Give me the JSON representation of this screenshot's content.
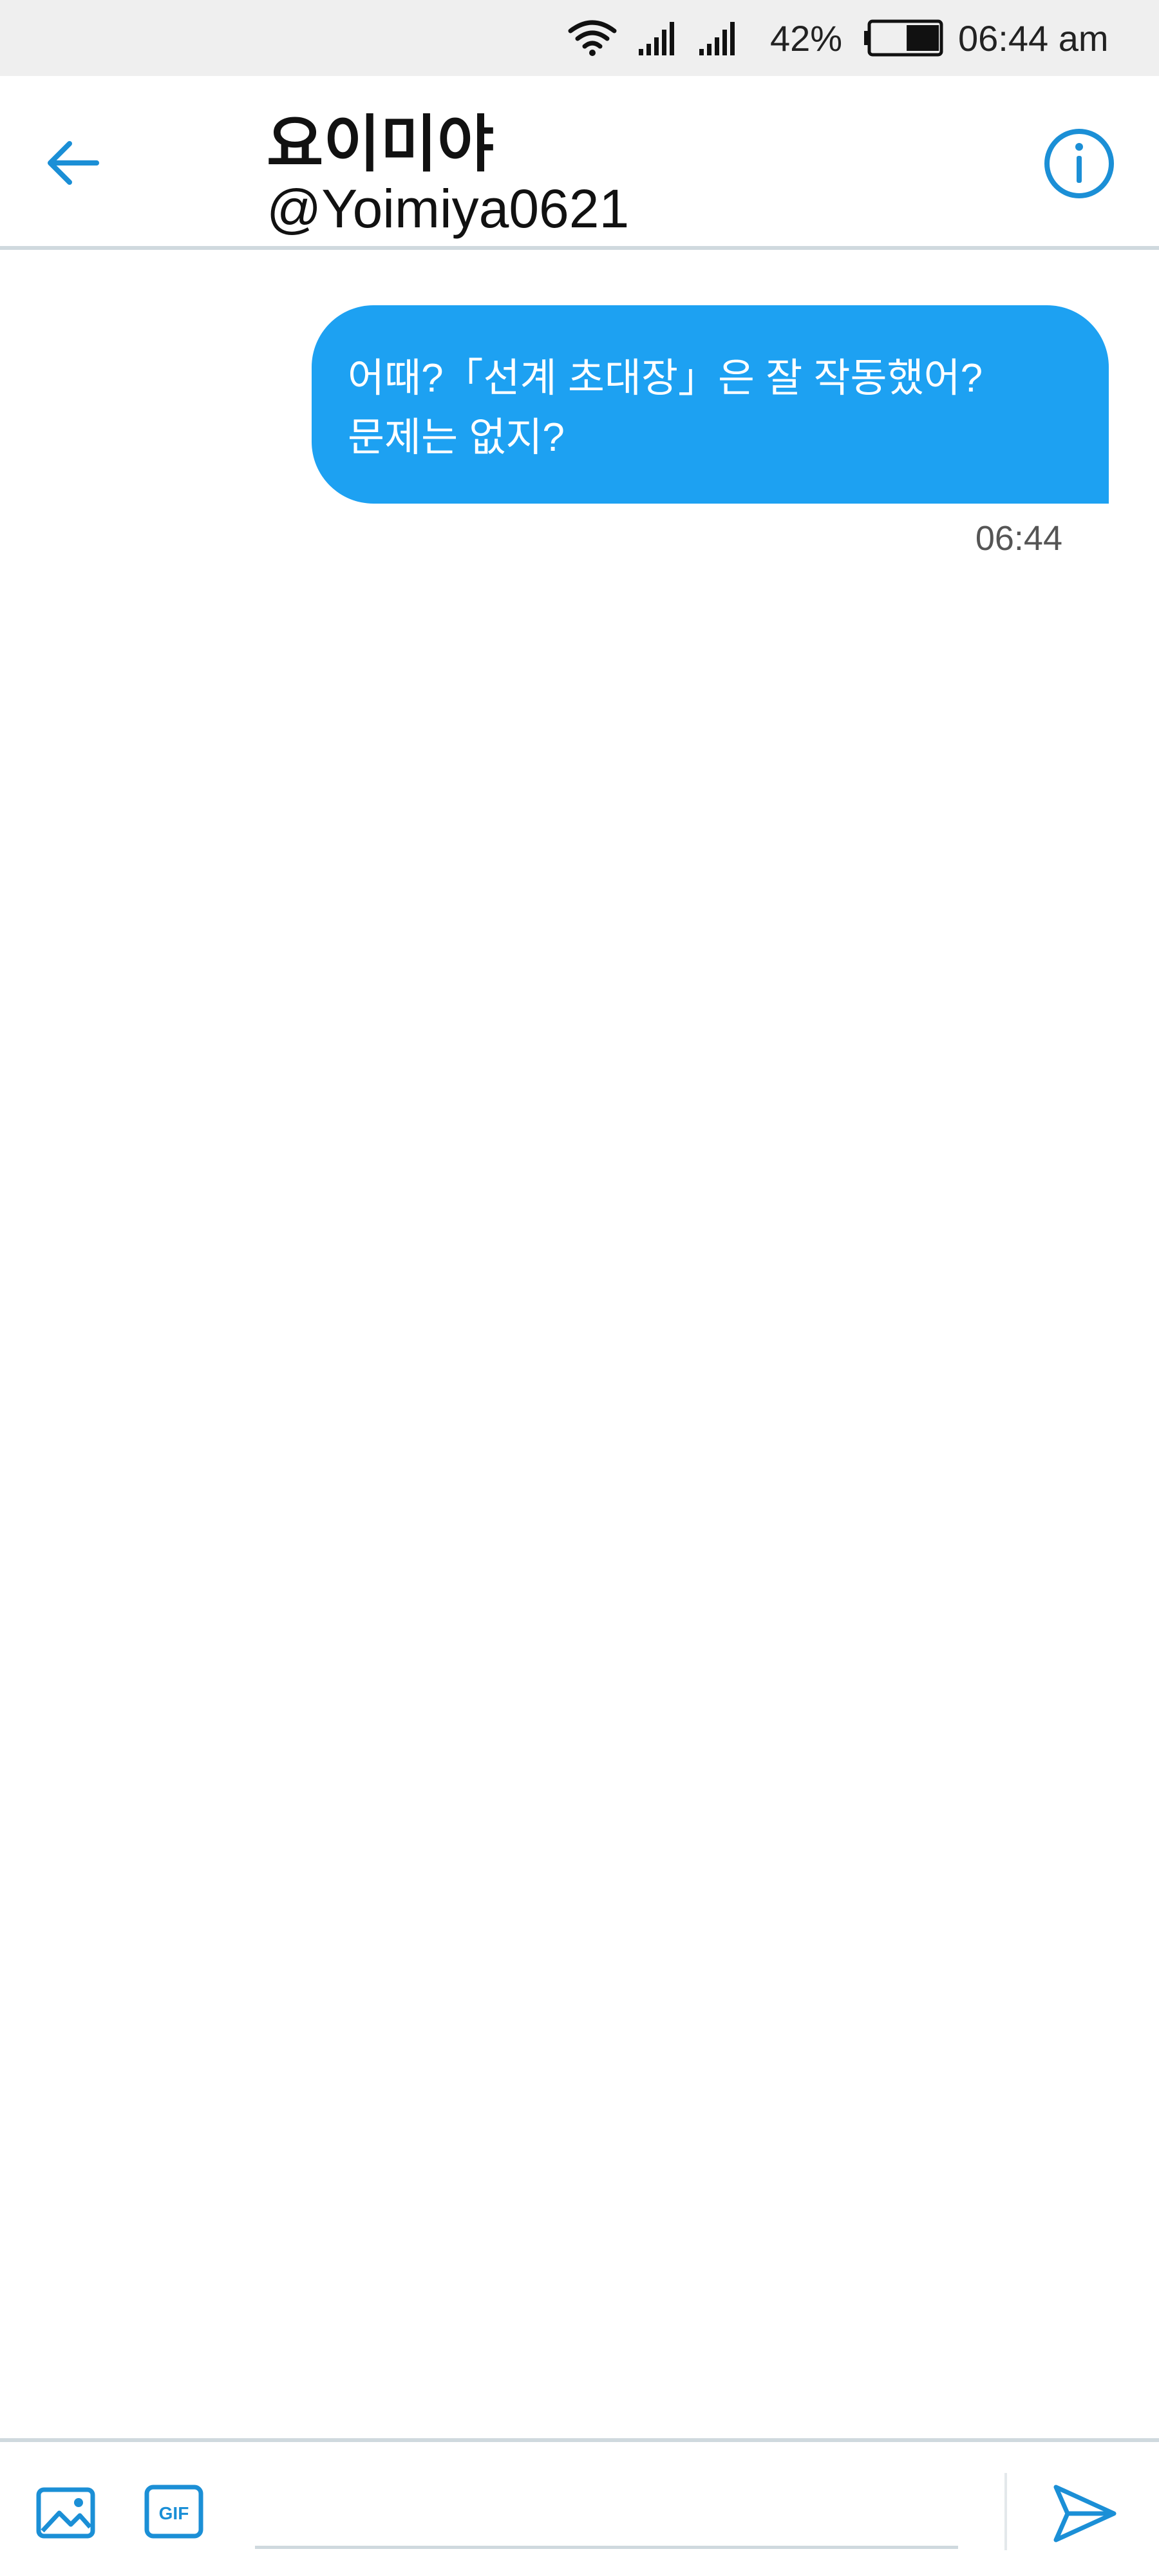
{
  "status_bar": {
    "battery_percent_text": "42%",
    "battery_level": 0.42,
    "time": "06:44 am",
    "icons": [
      "wifi-icon",
      "signal-icon",
      "signal-icon",
      "battery-icon"
    ]
  },
  "header": {
    "contact_name": "요이미야",
    "contact_handle": "@Yoimiya0621",
    "icons": {
      "back": "back-arrow-icon",
      "info": "info-icon"
    }
  },
  "conversation": {
    "messages": [
      {
        "direction": "sent",
        "lines": [
          "어때?「선계 초대장」은 잘 작동했어?",
          "문제는 없지?"
        ],
        "time": "06:44"
      }
    ]
  },
  "composer": {
    "input_value": "",
    "icons": {
      "image": "image-icon",
      "gif": "gif-icon",
      "send": "send-icon"
    }
  },
  "colors": {
    "accent": "#1da1f2",
    "icon_blue": "#1b8fd6",
    "status_bar_bg": "#efefef",
    "divider": "#cfd9de",
    "bubble_text": "#ffffff"
  }
}
